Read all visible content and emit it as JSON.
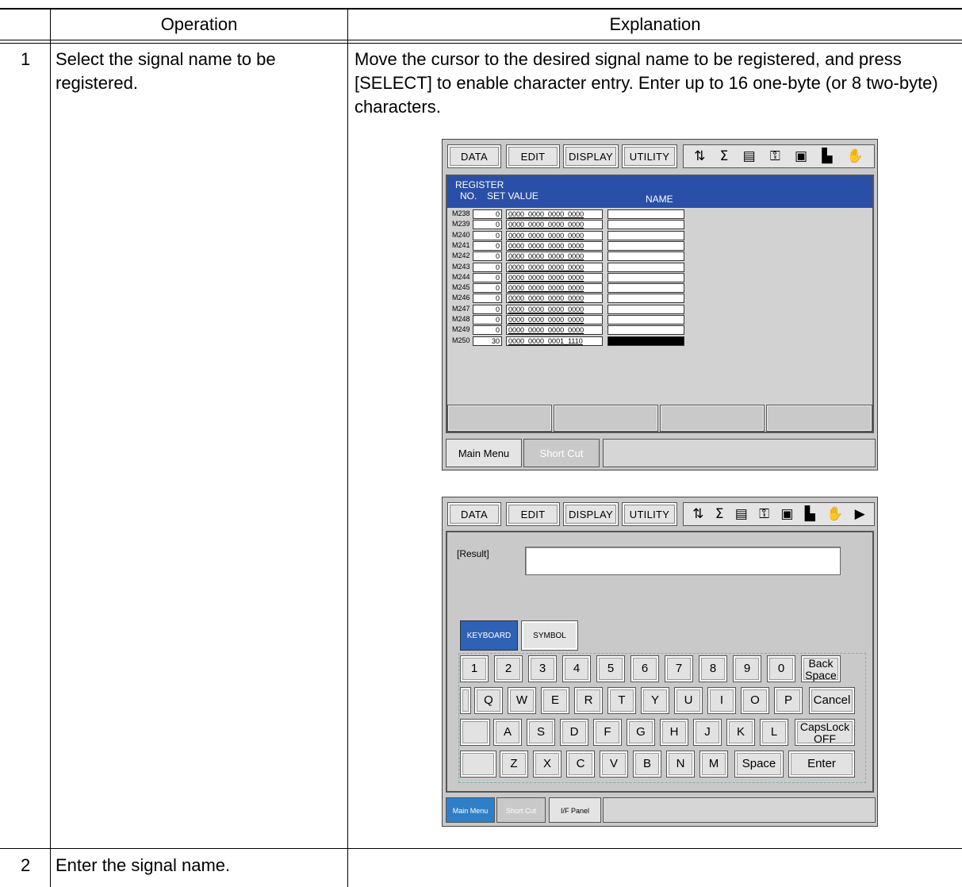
{
  "table": {
    "headers": {
      "operation": "Operation",
      "explanation": "Explanation"
    },
    "rows": [
      {
        "num": "1",
        "operation": "Select the signal name to be registered.",
        "explanation": "Move the cursor to the desired signal name to be registered, and press [SELECT] to enable character entry.  Enter up to 16 one-byte (or 8 two-byte) characters."
      },
      {
        "num": "2",
        "operation": "Enter the signal name.",
        "explanation": ""
      }
    ]
  },
  "menu": {
    "data": "DATA",
    "edit": "EDIT",
    "display": "DISPLAY",
    "utility": "UTILITY"
  },
  "icons": [
    "io-icon",
    "sigma-icon",
    "gear-stats-icon",
    "key-icon",
    "teach-icon",
    "page-icon",
    "hand-icon",
    "play-icon"
  ],
  "screen1": {
    "title": "REGISTER",
    "col_no": "NO.",
    "col_set_value": "SET VALUE",
    "col_name": "NAME",
    "registers": [
      {
        "no": "M238",
        "value": "0",
        "bits": "0000_0000_0000_0000"
      },
      {
        "no": "M239",
        "value": "0",
        "bits": "0000_0000_0000_0000"
      },
      {
        "no": "M240",
        "value": "0",
        "bits": "0000_0000_0000_0000"
      },
      {
        "no": "M241",
        "value": "0",
        "bits": "0000_0000_0000_0000"
      },
      {
        "no": "M242",
        "value": "0",
        "bits": "0000_0000_0000_0000"
      },
      {
        "no": "M243",
        "value": "0",
        "bits": "0000_0000_0000_0000"
      },
      {
        "no": "M244",
        "value": "0",
        "bits": "0000_0000_0000_0000"
      },
      {
        "no": "M245",
        "value": "0",
        "bits": "0000_0000_0000_0000"
      },
      {
        "no": "M246",
        "value": "0",
        "bits": "0000_0000_0000_0000"
      },
      {
        "no": "M247",
        "value": "0",
        "bits": "0000_0000_0000_0000"
      },
      {
        "no": "M248",
        "value": "0",
        "bits": "0000_0000_0000_0000"
      },
      {
        "no": "M249",
        "value": "0",
        "bits": "0000_0000_0000_0000"
      },
      {
        "no": "M250",
        "value": "30",
        "bits": "0000_0000_0001_1110"
      }
    ],
    "main_menu": "Main Menu",
    "short_cut": "Short Cut"
  },
  "screen2": {
    "result_label": "[Result]",
    "result_value": "",
    "tab_keyboard": "KEYBOARD",
    "tab_symbol": "SYMBOL",
    "row1": [
      "1",
      "2",
      "3",
      "4",
      "5",
      "6",
      "7",
      "8",
      "9",
      "0"
    ],
    "row2": [
      "Q",
      "W",
      "E",
      "R",
      "T",
      "Y",
      "U",
      "I",
      "O",
      "P"
    ],
    "row3": [
      "A",
      "S",
      "D",
      "F",
      "G",
      "H",
      "J",
      "K",
      "L"
    ],
    "row4": [
      "Z",
      "X",
      "C",
      "V",
      "B",
      "N",
      "M"
    ],
    "backspace_line1": "Back",
    "backspace_line2": "Space",
    "cancel": "Cancel",
    "capslock_line1": "CapsLock",
    "capslock_line2": "OFF",
    "space": "Space",
    "enter": "Enter",
    "main_menu": "Main Menu",
    "short_cut": "Short Cut",
    "if_panel": "I/F Panel"
  }
}
